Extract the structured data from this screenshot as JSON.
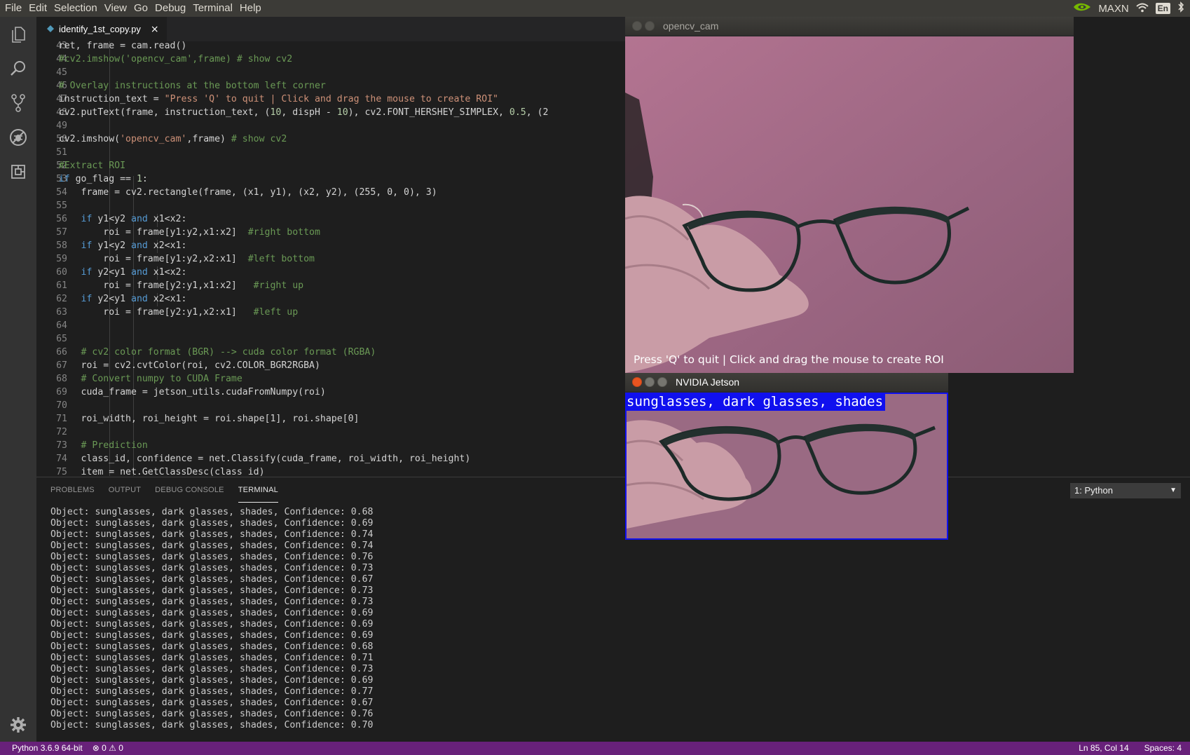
{
  "menubar": {
    "items": [
      "File",
      "Edit",
      "Selection",
      "View",
      "Go",
      "Debug",
      "Terminal",
      "Help"
    ],
    "tray": {
      "power_mode": "MAXN",
      "language": "En"
    }
  },
  "activitybar": {
    "icons": [
      "files-icon",
      "search-icon",
      "source-control-icon",
      "debug-icon",
      "extensions-icon",
      "gear-icon"
    ]
  },
  "editor": {
    "tab": {
      "filename": "identify_1st_copy.py",
      "close": "×"
    },
    "line_numbers": [
      "43",
      "44",
      "45",
      "46",
      "47",
      "48",
      "49",
      "50",
      "51",
      "52",
      "53",
      "54",
      "55",
      "56",
      "57",
      "58",
      "59",
      "60",
      "61",
      "62",
      "63",
      "64",
      "65",
      "66",
      "67",
      "68",
      "69",
      "70",
      "71",
      "72",
      "73",
      "74",
      "75"
    ],
    "lines": {
      "l43": "    ret, frame = cam.read()",
      "l44": "    #cv2.imshow('opencv_cam',frame) # show cv2",
      "l46": "    # Overlay instructions at the bottom left corner",
      "l47a": "    instruction_text = ",
      "l47b": "\"Press 'Q' to quit | Click and drag the mouse to create ROI\"",
      "l48a": "    cv2.putText(frame, instruction_text, (",
      "l48b": "10",
      "l48c": ", dispH - ",
      "l48d": "10",
      "l48e": "), cv2.FONT_HERSHEY_SIMPLEX, ",
      "l48f": "0.5",
      "l48g": ", (2",
      "l50a": "    cv2.imshow(",
      "l50b": "'opencv_cam'",
      "l50c": ",frame) ",
      "l50d": "# show cv2",
      "l52": "    #Extract ROI",
      "l53a": "    ",
      "l53b": "if",
      "l53c": " go_flag == ",
      "l53d": "1",
      "l53e": ":",
      "l54": "        frame = cv2.rectangle(frame, (x1, y1), (x2, y2), (255, 0, 0), 3)",
      "l56": "        if y1<y2 and x1<x2:",
      "l57a": "            roi = frame[y1:y2,x1:x2]  ",
      "l57b": "#right bottom",
      "l58": "        if y1<y2 and x2<x1:",
      "l59a": "            roi = frame[y1:y2,x2:x1]  ",
      "l59b": "#left bottom",
      "l60": "        if y2<y1 and x1<x2:",
      "l61a": "            roi = frame[y2:y1,x1:x2]   ",
      "l61b": "#right up",
      "l62": "        if y2<y1 and x2<x1:",
      "l63a": "            roi = frame[y2:y1,x2:x1]   ",
      "l63b": "#left up",
      "l66": "        # cv2 color format (BGR) --> cuda color format (RGBA)",
      "l67": "        roi = cv2.cvtColor(roi, cv2.COLOR_BGR2RGBA)",
      "l68": "        # Convert numpy to CUDA Frame",
      "l69": "        cuda_frame = jetson_utils.cudaFromNumpy(roi)",
      "l71": "        roi_width, roi_height = roi.shape[1], roi.shape[0]",
      "l73": "        # Prediction",
      "l74": "        class_id, confidence = net.Classify(cuda_frame, roi_width, roi_height)",
      "l75": "        item = net.GetClassDesc(class_id)"
    }
  },
  "panel": {
    "tabs": [
      "PROBLEMS",
      "OUTPUT",
      "DEBUG CONSOLE",
      "TERMINAL"
    ],
    "active_tab": "TERMINAL",
    "terminal_select": "1: Python",
    "terminal_lines": [
      "Object: sunglasses, dark glasses, shades, Confidence: 0.68",
      "Object: sunglasses, dark glasses, shades, Confidence: 0.69",
      "Object: sunglasses, dark glasses, shades, Confidence: 0.74",
      "Object: sunglasses, dark glasses, shades, Confidence: 0.74",
      "Object: sunglasses, dark glasses, shades, Confidence: 0.76",
      "Object: sunglasses, dark glasses, shades, Confidence: 0.73",
      "Object: sunglasses, dark glasses, shades, Confidence: 0.67",
      "Object: sunglasses, dark glasses, shades, Confidence: 0.73",
      "Object: sunglasses, dark glasses, shades, Confidence: 0.73",
      "Object: sunglasses, dark glasses, shades, Confidence: 0.69",
      "Object: sunglasses, dark glasses, shades, Confidence: 0.69",
      "Object: sunglasses, dark glasses, shades, Confidence: 0.69",
      "Object: sunglasses, dark glasses, shades, Confidence: 0.68",
      "Object: sunglasses, dark glasses, shades, Confidence: 0.71",
      "Object: sunglasses, dark glasses, shades, Confidence: 0.73",
      "Object: sunglasses, dark glasses, shades, Confidence: 0.69",
      "Object: sunglasses, dark glasses, shades, Confidence: 0.77",
      "Object: sunglasses, dark glasses, shades, Confidence: 0.67",
      "Object: sunglasses, dark glasses, shades, Confidence: 0.76",
      "Object: sunglasses, dark glasses, shades, Confidence: 0.70"
    ]
  },
  "statusbar": {
    "interpreter": "Python 3.6.9 64-bit",
    "errors": "0",
    "warnings": "0",
    "cursor": "Ln 85, Col 14",
    "spaces": "Spaces: 4"
  },
  "windows": {
    "opencv": {
      "title": "opencv_cam",
      "caption": "Press 'Q' to quit | Click and drag the mouse to create ROI"
    },
    "jetson": {
      "title": "NVIDIA Jetson",
      "label": "sunglasses, dark glasses, shades"
    }
  },
  "colors": {
    "statusbar": "#68217a",
    "roi_box": "#1010ee",
    "camera_background": "#9f6480"
  }
}
